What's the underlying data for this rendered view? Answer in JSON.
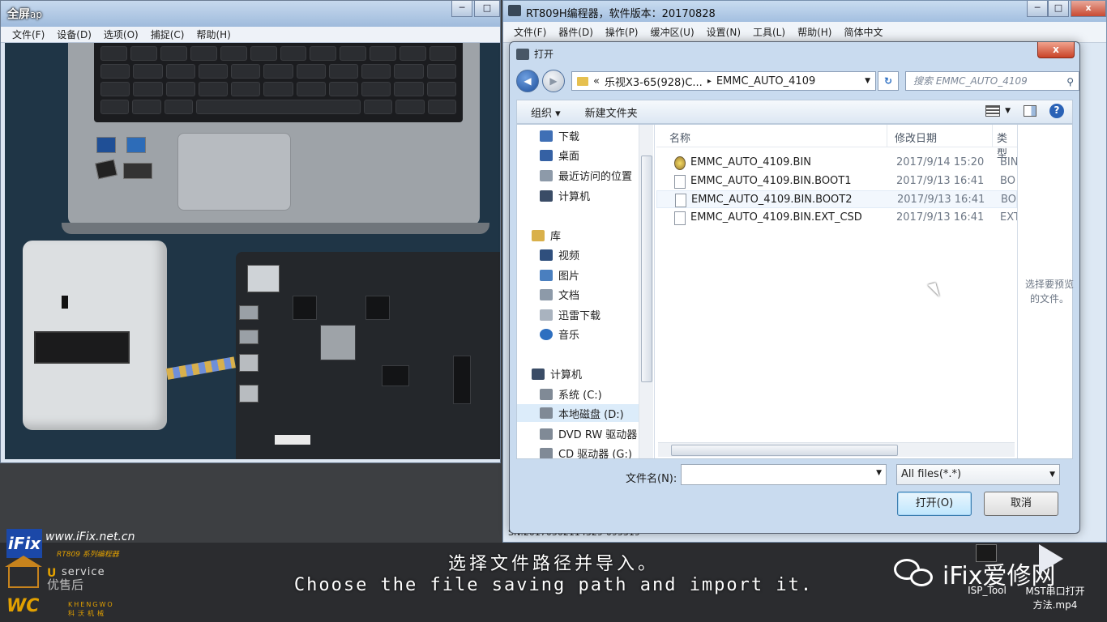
{
  "amcap": {
    "title": "全屏",
    "title_rest": "ap",
    "menu": [
      "文件(F)",
      "设备(D)",
      "选项(O)",
      "捕捉(C)",
      "帮助(H)"
    ]
  },
  "rt809": {
    "title": "RT809H编程器，软件版本：20170828",
    "menu": [
      "文件(F)",
      "器件(D)",
      "操作(P)",
      "缓冲区(U)",
      "设置(N)",
      "工具(L)",
      "帮助(H)",
      "简体中文"
    ],
    "status": "SN:20170502114329-095319"
  },
  "dialog": {
    "title": "打开",
    "close": "x",
    "breadcrumb": [
      "«",
      "乐视X3-65(928)C...",
      "▸",
      "EMMC_AUTO_4109"
    ],
    "search_placeholder": "搜索 EMMC_AUTO_4109",
    "toolbar": {
      "organize": "组织 ▾",
      "new_folder": "新建文件夹"
    },
    "nav": [
      {
        "label": "下载",
        "color": "#3f6fb5"
      },
      {
        "label": "桌面",
        "color": "#3561a4"
      },
      {
        "label": "最近访问的位置",
        "color": "#8d9aa9"
      },
      {
        "label": "计算机",
        "color": "#3a4c66"
      },
      {
        "label": "库",
        "color": "#d9b04a"
      },
      {
        "label": "视频",
        "color": "#2f4f7d"
      },
      {
        "label": "图片",
        "color": "#4a7fbf"
      },
      {
        "label": "文档",
        "color": "#8d9aa9"
      },
      {
        "label": "迅雷下载",
        "color": "#a9b3bf"
      },
      {
        "label": "音乐",
        "color": "#2e6fc0"
      },
      {
        "label": "计算机",
        "color": "#3a4c66"
      },
      {
        "label": "系统 (C:)",
        "color": "#808a96"
      },
      {
        "label": "本地磁盘 (D:)",
        "color": "#808a96"
      },
      {
        "label": "DVD RW 驱动器",
        "color": "#808a96"
      },
      {
        "label": "CD 驱动器 (G:)",
        "color": "#808a96"
      }
    ],
    "columns": {
      "name": "名称",
      "date": "修改日期",
      "type": "类型"
    },
    "files": [
      {
        "name": "EMMC_AUTO_4109.BIN",
        "date": "2017/9/14 15:20",
        "type": "BIN"
      },
      {
        "name": "EMMC_AUTO_4109.BIN.BOOT1",
        "date": "2017/9/13 16:41",
        "type": "BO"
      },
      {
        "name": "EMMC_AUTO_4109.BIN.BOOT2",
        "date": "2017/9/13 16:41",
        "type": "BO"
      },
      {
        "name": "EMMC_AUTO_4109.BIN.EXT_CSD",
        "date": "2017/9/13 16:41",
        "type": "EXT"
      }
    ],
    "preview_text": "选择要预览的文件。",
    "filename_label": "文件名(N):",
    "filename_value": "",
    "filter": "All files(*.*)",
    "open_btn": "打开(O)",
    "cancel_btn": "取消"
  },
  "captions": {
    "cn": "选择文件路径并导入。",
    "en": "Choose the file saving path and import it."
  },
  "watermarks": {
    "ifix_logo": "iFix",
    "ifix_url": "www.iFix.net.cn",
    "ifix_sub": "RT809 系列编程器",
    "u_letter": "U",
    "service": "service",
    "service_cn": "优售后",
    "wc_logo": "WC",
    "wc_sub_en": "KHENGWO",
    "wc_sub_cn": "科沃机械",
    "brand": "iFix爱修网"
  },
  "desktop_icons": [
    {
      "label": "ISP_Tool"
    },
    {
      "label": "MST串口打开方法.mp4"
    }
  ],
  "colors": {
    "accent": "#2a62b6",
    "selection": "#dcecfa",
    "caption": "#ffffff"
  }
}
